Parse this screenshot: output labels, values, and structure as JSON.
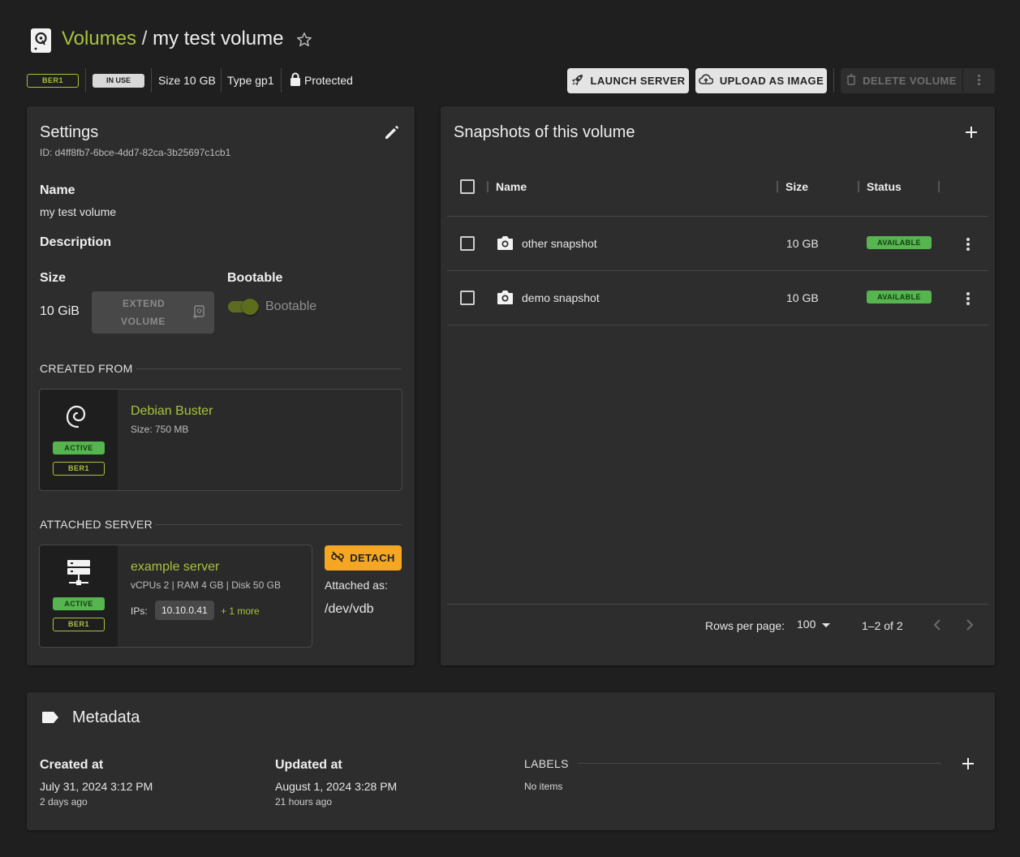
{
  "header": {
    "breadcrumb_root": "Volumes",
    "breadcrumb_sep": "/",
    "title": "my test volume"
  },
  "chips": {
    "region": "BER1",
    "status": "IN USE",
    "size": "Size 10 GB",
    "type": "Type gp1",
    "protected": "Protected"
  },
  "actions": {
    "launch": "LAUNCH SERVER",
    "upload": "UPLOAD AS IMAGE",
    "delete": "DELETE VOLUME"
  },
  "settings": {
    "title": "Settings",
    "id": "ID: d4ff8fb7-6bce-4dd7-82ca-3b25697c1cb1",
    "name_label": "Name",
    "name_value": "my test volume",
    "description_label": "Description",
    "size_label": "Size",
    "size_value": "10 GiB",
    "extend_line1": "EXTEND",
    "extend_line2": "VOLUME",
    "bootable_label": "Bootable",
    "bootable_toggle_label": "Bootable",
    "created_from_label": "CREATED FROM",
    "image": {
      "name": "Debian Buster",
      "size": "Size: 750 MB",
      "status": "ACTIVE",
      "region": "BER1"
    },
    "attached_label": "ATTACHED SERVER",
    "server": {
      "name": "example server",
      "specs": "vCPUs 2 | RAM 4 GB | Disk 50 GB",
      "ips_label": "IPs:",
      "ip": "10.10.0.41",
      "more": "+ 1 more",
      "status": "ACTIVE",
      "region": "BER1"
    },
    "detach": "DETACH",
    "attached_as_label": "Attached as:",
    "attached_as_value": "/dev/vdb"
  },
  "snapshots": {
    "title": "Snapshots of this volume",
    "columns": [
      "Name",
      "Size",
      "Status"
    ],
    "rows": [
      {
        "name": "other snapshot",
        "size": "10 GB",
        "status": "AVAILABLE"
      },
      {
        "name": "demo snapshot",
        "size": "10 GB",
        "status": "AVAILABLE"
      }
    ],
    "rows_per_page_label": "Rows per page:",
    "rows_per_page": "100",
    "range": "1–2 of 2"
  },
  "metadata": {
    "title": "Metadata",
    "created_label": "Created at",
    "created_value": "July 31, 2024 3:12 PM",
    "created_rel": "2 days ago",
    "updated_label": "Updated at",
    "updated_value": "August 1, 2024 3:28 PM",
    "updated_rel": "21 hours ago",
    "labels_label": "LABELS",
    "labels_empty": "No items"
  },
  "colors": {
    "accent": "#a8c23d",
    "active_green": "#56b54f",
    "detach_orange": "#f5a623"
  }
}
